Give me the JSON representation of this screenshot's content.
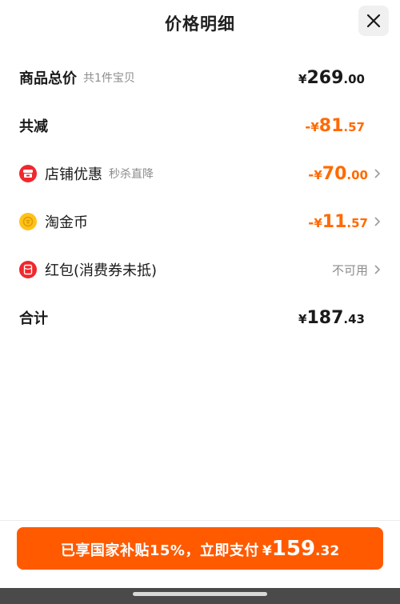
{
  "header": {
    "title": "价格明细"
  },
  "rows": {
    "total": {
      "label": "商品总价",
      "sub": "共1件宝贝",
      "currency": "¥",
      "int": "269",
      "dec": ".00"
    },
    "reduction": {
      "label": "共减",
      "prefix": "-",
      "currency": "¥",
      "int": "81",
      "dec": ".57"
    },
    "store": {
      "label": "店铺优惠",
      "sub": "秒杀直降",
      "prefix": "-",
      "currency": "¥",
      "int": "70",
      "dec": ".00",
      "icon": "store-coupon-icon"
    },
    "coins": {
      "label": "淘金币",
      "prefix": "-",
      "currency": "¥",
      "int": "11",
      "dec": ".57",
      "icon": "gold-coin-icon"
    },
    "redpacket": {
      "label": "红包(消费券未抵)",
      "status": "不可用",
      "icon": "red-packet-icon"
    },
    "sum": {
      "label": "合计",
      "currency": "¥",
      "int": "187",
      "dec": ".43"
    }
  },
  "pay_button": {
    "text": "已享国家补贴15%，立即支付",
    "currency": "¥",
    "int": "159",
    "dec": ".32"
  },
  "colors": {
    "accent": "#ff6a00",
    "button": "#ff5a00",
    "store_icon": "#f0282d",
    "coin_icon": "#ffc21a",
    "redpacket_icon": "#f0282d"
  }
}
